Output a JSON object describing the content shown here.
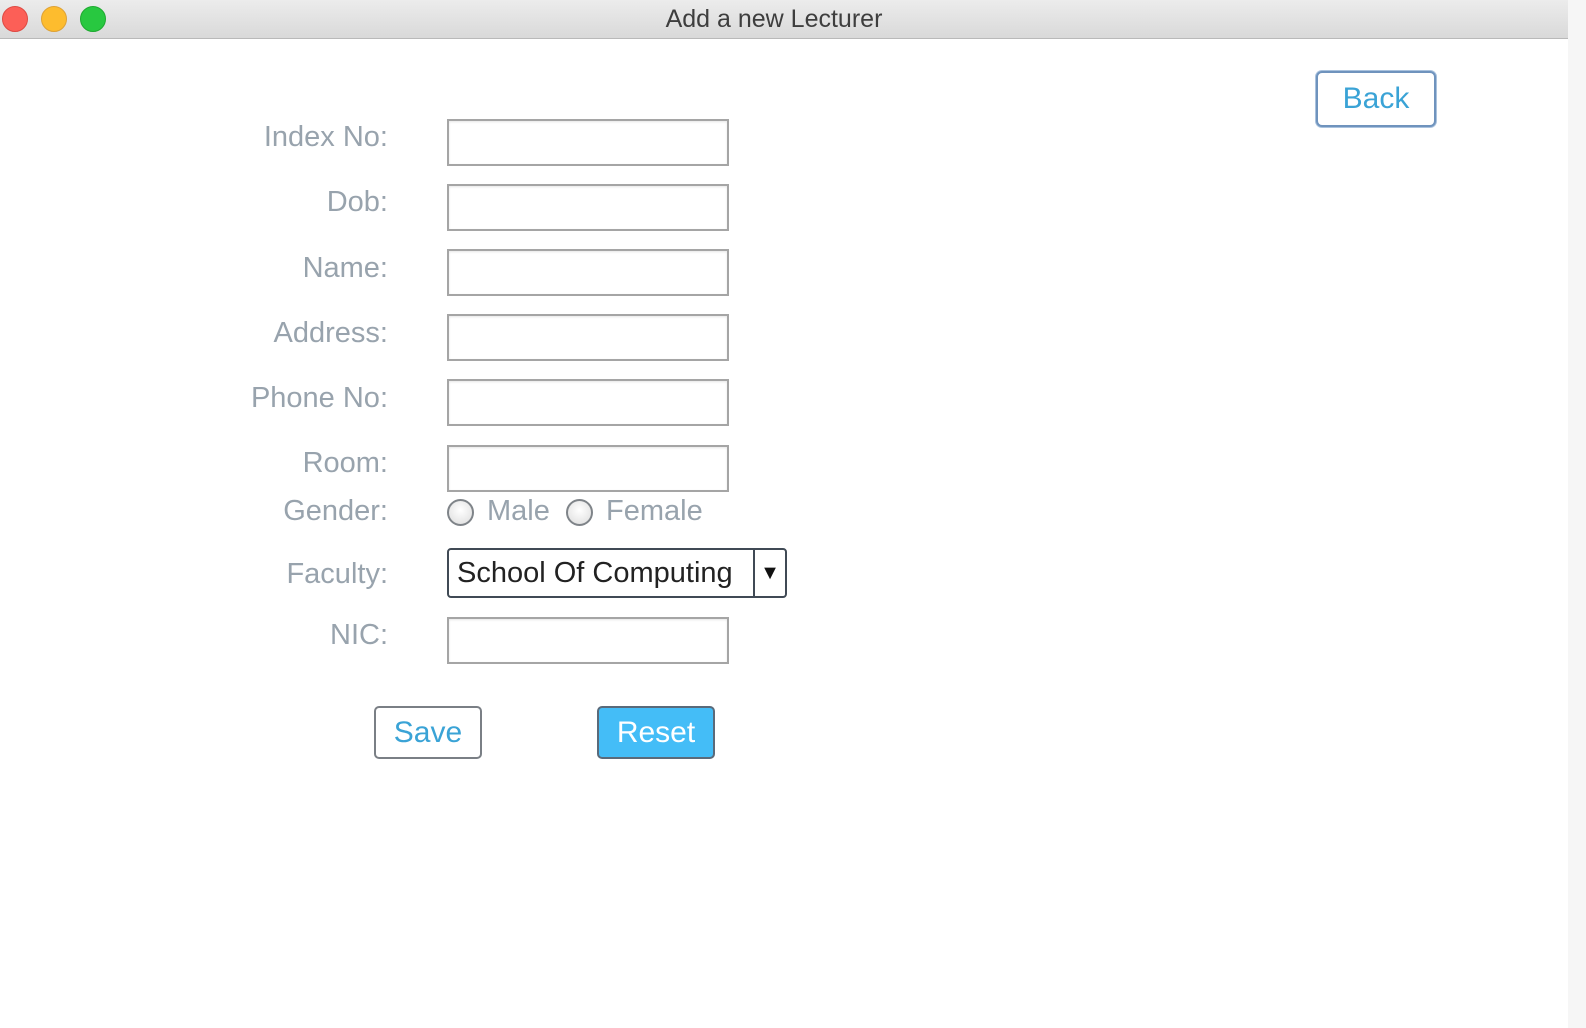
{
  "window": {
    "title": "Add a new Lecturer"
  },
  "toolbar": {
    "back_label": "Back"
  },
  "form": {
    "index_no_label": "Index No:",
    "dob_label": "Dob:",
    "name_label": "Name:",
    "address_label": "Address:",
    "phone_label": "Phone No:",
    "room_label": "Room:",
    "gender_label": "Gender:",
    "gender_options": [
      "Male",
      "Female"
    ],
    "faculty_label": "Faculty:",
    "faculty_selected": "School Of Computing",
    "nic_label": "NIC:",
    "index_no_value": "",
    "dob_value": "",
    "name_value": "",
    "address_value": "",
    "phone_value": "",
    "room_value": "",
    "nic_value": ""
  },
  "actions": {
    "save_label": "Save",
    "reset_label": "Reset"
  },
  "colors": {
    "accent": "#3aa3d6",
    "reset_bg": "#44bdf7",
    "label_text": "#98a3ad"
  }
}
